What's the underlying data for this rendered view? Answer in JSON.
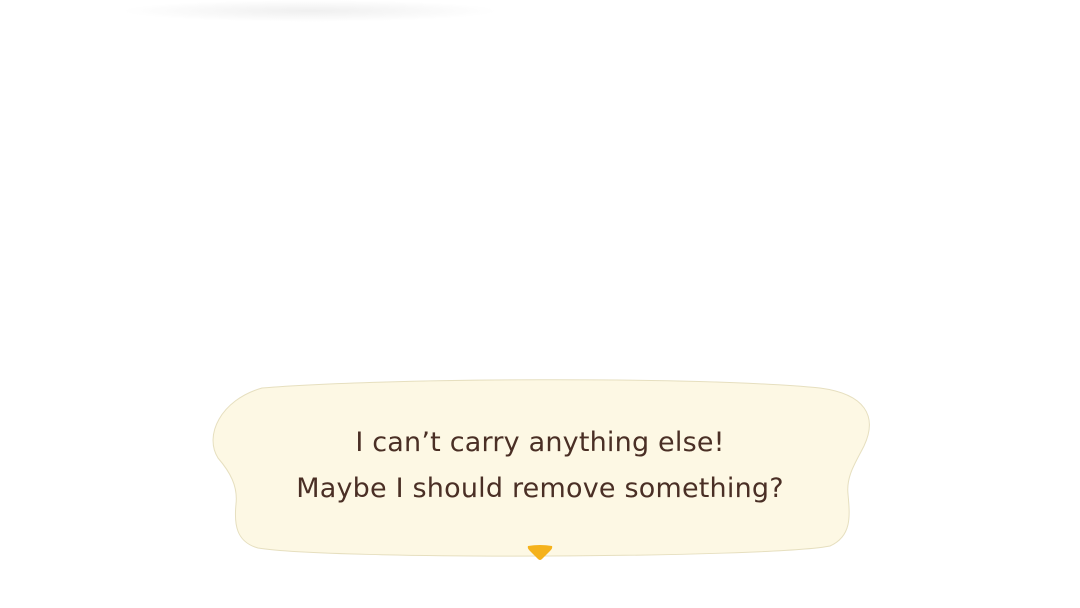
{
  "dialogue": {
    "line1": "I can’t carry anything else!",
    "line2": "Maybe I should remove something?",
    "advance_icon": "triangle-down-icon"
  },
  "colors": {
    "background": "#ffffff",
    "bubble_fill": "#fdf8e4",
    "bubble_edge": "#e6dfbf",
    "text": "#4a2f25",
    "arrow": "#f5b21b"
  }
}
